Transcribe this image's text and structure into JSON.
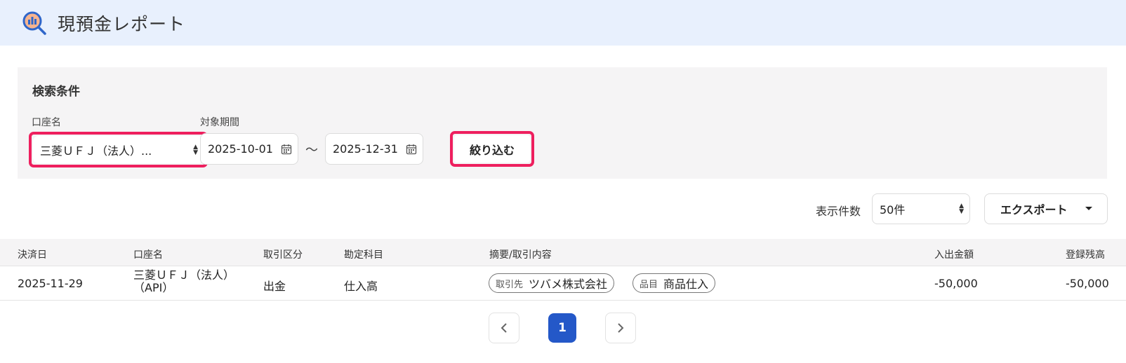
{
  "header": {
    "title": "現預金レポート",
    "logo_icon": "report-search-icon"
  },
  "search": {
    "panel_title": "検索条件",
    "account_label": "口座名",
    "account_value": "三菱ＵＦＪ（法人）...",
    "period_label": "対象期間",
    "date_from": "2025-10-01",
    "date_sep": "〜",
    "date_to": "2025-12-31",
    "filter_button": "絞り込む",
    "highlight_color": "#ee1f5e"
  },
  "toolbar": {
    "display_count_label": "表示件数",
    "display_count_value": "50件",
    "export_button": "エクスポート"
  },
  "table": {
    "columns": [
      "決済日",
      "口座名",
      "取引区分",
      "勘定科目",
      "摘要/取引内容",
      "入出金額",
      "登録残高"
    ],
    "rows": [
      {
        "date": "2025-11-29",
        "account_line1": "三菱ＵＦＪ（法人）",
        "account_line2": "（API）",
        "type": "出金",
        "subject": "仕入高",
        "tags": [
          {
            "key": "取引先",
            "value": "ツバメ株式会社"
          },
          {
            "key": "品目",
            "value": "商品仕入"
          }
        ],
        "amount": "-50,000",
        "balance": "-50,000"
      }
    ]
  },
  "pagination": {
    "current_page": "1",
    "prev_icon": "chevron-left-icon",
    "next_icon": "chevron-right-icon",
    "accent": "#2458c8"
  }
}
